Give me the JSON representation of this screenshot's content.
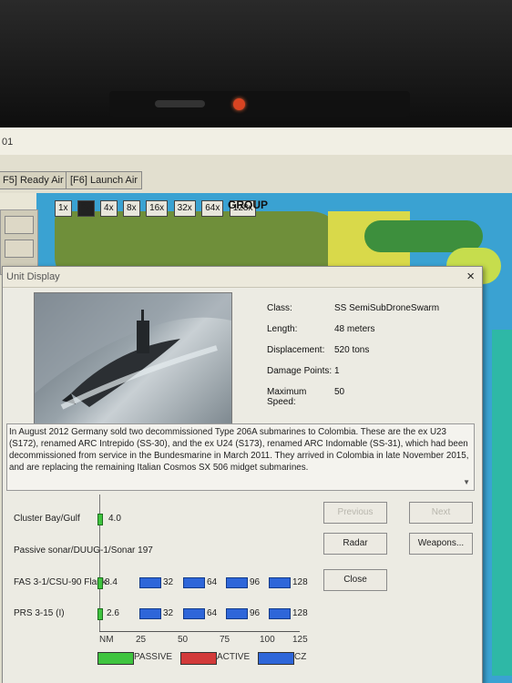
{
  "window_title": "01",
  "command_buttons": {
    "ready_air": "F5] Ready Air",
    "launch_air": "[F6] Launch Air"
  },
  "zoom": {
    "options": [
      "1x",
      "2x",
      "4x",
      "8x",
      "16x",
      "32x",
      "64x",
      "128x"
    ],
    "selected": "2x",
    "group_label": "GROUP"
  },
  "unit_display": {
    "title": "Unit Display",
    "close_glyph": "×",
    "stats": {
      "class_label": "Class:",
      "class_value": "SS  SemiSubDroneSwarm",
      "length_label": "Length:",
      "length_value": "48 meters",
      "displacement_label": "Displacement:",
      "displacement_value": "520 tons",
      "damage_label": "Damage Points:",
      "damage_value": "1",
      "maxspeed_label_1": "Maximum",
      "maxspeed_label_2": "Speed:",
      "maxspeed_value": "50"
    },
    "description": "In August 2012 Germany sold two decommissioned Type 206A submarines to Colombia. These are the ex U23 (S172), renamed ARC Intrepido (SS-30), and the ex U24 (S173), renamed ARC Indomable (SS-31), which had been decommissioned from service in the Bundesmarine in March 2011. They arrived in Colombia in late November 2015, and are replacing the remaining Italian Cosmos SX 506 midget submarines.",
    "buttons": {
      "previous": "Previous",
      "next": "Next",
      "radar": "Radar",
      "weapons": "Weapons...",
      "close": "Close"
    },
    "sensors": [
      {
        "label": "Cluster Bay/Gulf",
        "value": "4.0"
      },
      {
        "label": "Passive sonar/DUUG-1/Sonar 197",
        "value": ""
      },
      {
        "label": "FAS 3-1/CSU-90 Flank",
        "value": "8.4"
      },
      {
        "label": "PRS 3-15 (I)",
        "value": "2.6"
      }
    ],
    "range_marks": [
      "32",
      "64",
      "96",
      "128"
    ],
    "axis": {
      "unit": "NM",
      "ticks": [
        "25",
        "50",
        "75",
        "100",
        "125"
      ]
    },
    "legend": {
      "passive": "PASSIVE",
      "active": "ACTIVE",
      "cz": "CZ",
      "passive_color": "#3fc43f",
      "active_color": "#d23a3a",
      "cz_color": "#2e66d9"
    }
  }
}
